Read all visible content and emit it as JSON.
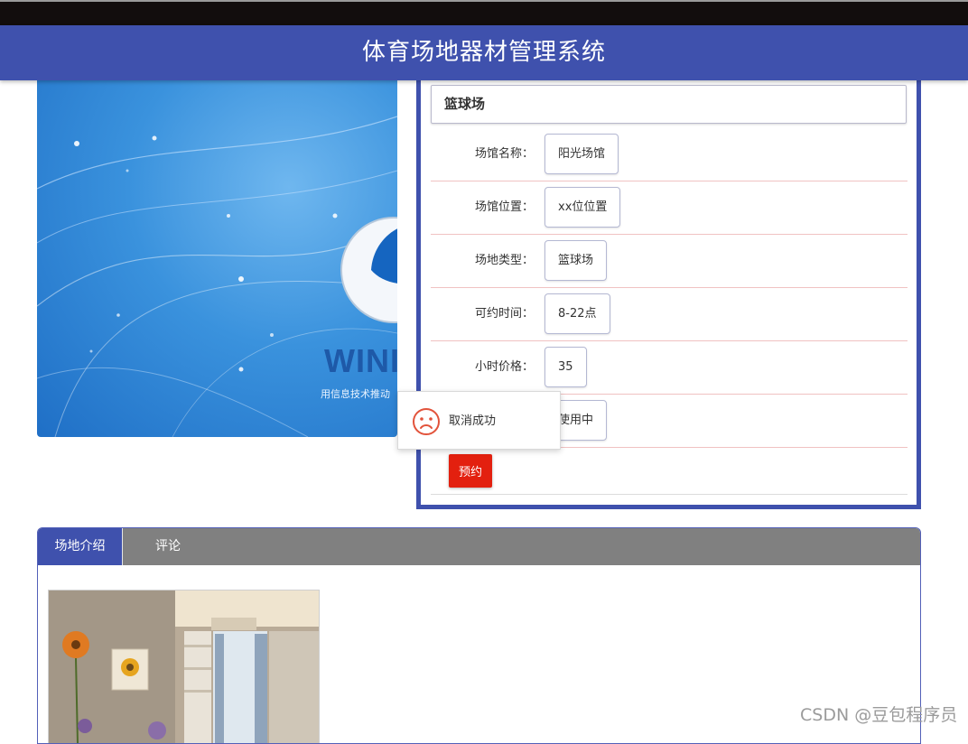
{
  "header": {
    "title": "体育场地器材管理系统"
  },
  "banner": {
    "logo_text": "WINI",
    "slogan": "用信息技术推动"
  },
  "venue": {
    "title": "篮球场",
    "fields": [
      {
        "label": "场馆名称：",
        "value": "阳光场馆"
      },
      {
        "label": "场馆位置：",
        "value": "xx位位置"
      },
      {
        "label": "场地类型：",
        "value": "篮球场"
      },
      {
        "label": "可约时间：",
        "value": "8-22点"
      },
      {
        "label": "小时价格：",
        "value": "35"
      },
      {
        "label": "",
        "value": "使用中"
      }
    ],
    "book_button": "预约"
  },
  "toast": {
    "message": "取消成功",
    "icon": "sad-face-icon"
  },
  "tabs": [
    {
      "label": "场地介绍",
      "active": true
    },
    {
      "label": "评论",
      "active": false
    }
  ],
  "watermark": "CSDN @豆包程序员",
  "colors": {
    "primary": "#3f51ad",
    "danger": "#e3200f",
    "tab_inactive": "#808080"
  }
}
